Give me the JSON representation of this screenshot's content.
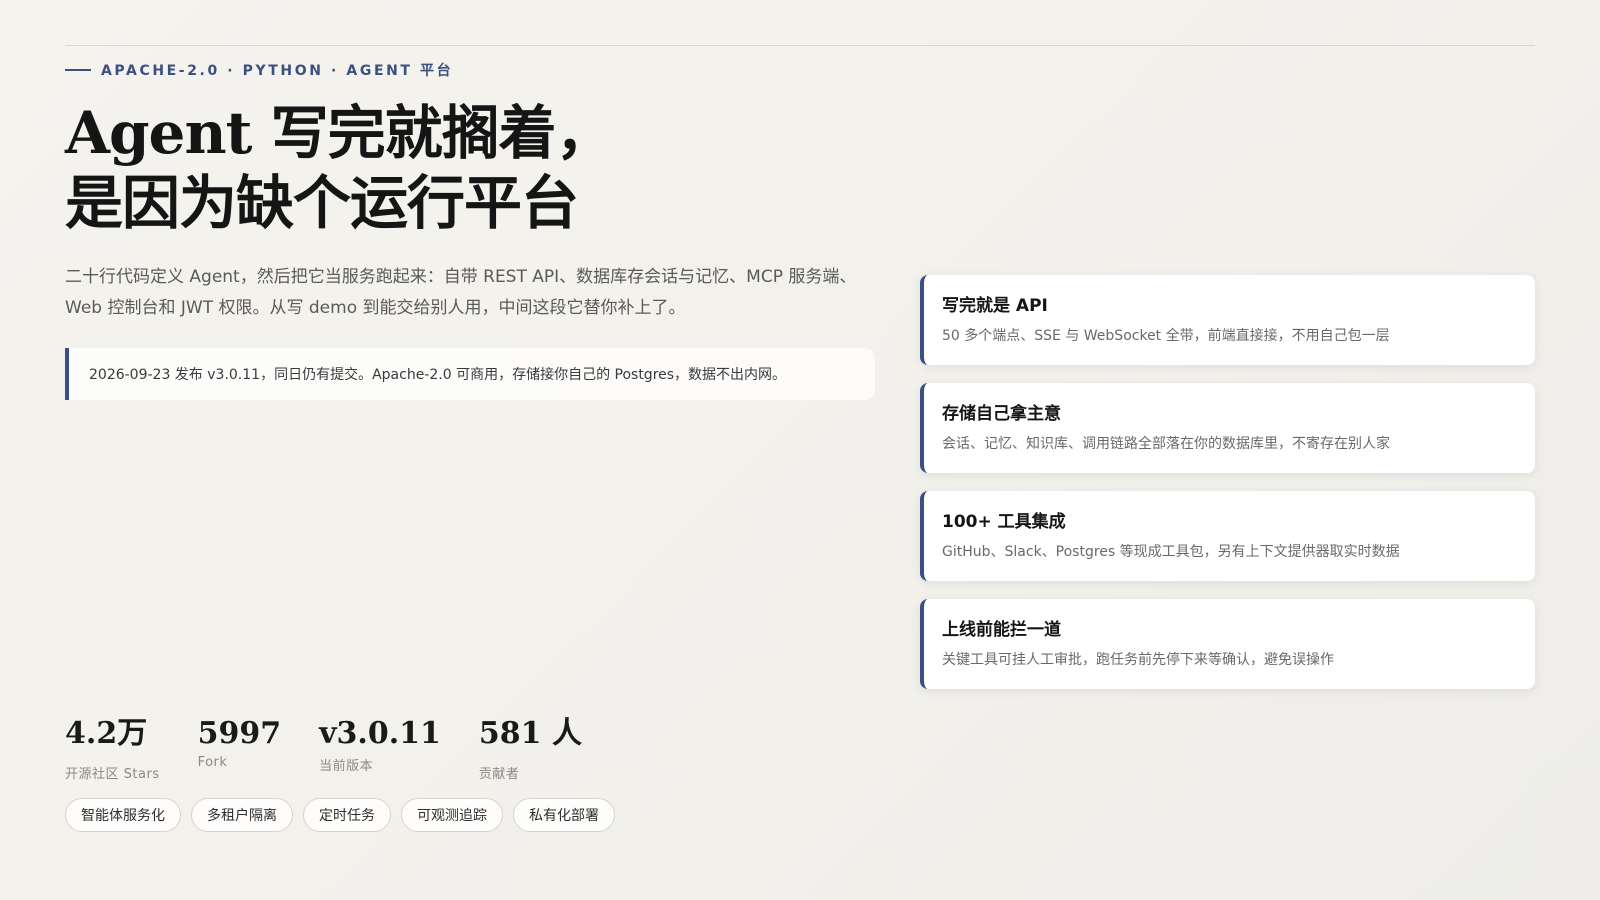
{
  "hero": {
    "eyebrow": "APACHE-2.0 · PYTHON · AGENT 平台",
    "headline_line1": "Agent 写完就搁着，",
    "headline_line2": "是因为缺个运行平台",
    "lede": "二十行代码定义 Agent，然后把它当服务跑起来：自带 REST API、数据库存会话与记忆、MCP 服务端、Web 控制台和 JWT 权限。从写 demo 到能交给别人用，中间这段它替你补上了。",
    "note": "2026-09-23 发布 v3.0.11，同日仍有提交。Apache-2.0 可商用，存储接你自己的 Postgres，数据不出内网。"
  },
  "stats": [
    {
      "value": "4.2万",
      "label": "开源社区 Stars"
    },
    {
      "value": "5997",
      "label": "Fork"
    },
    {
      "value": "v3.0.11",
      "label": "当前版本"
    },
    {
      "value": "581 人",
      "label": "贡献者"
    }
  ],
  "tags": [
    "智能体服务化",
    "多租户隔离",
    "定时任务",
    "可观测追踪",
    "私有化部署"
  ],
  "features": [
    {
      "title": "写完就是 API",
      "desc": "50 多个端点、SSE 与 WebSocket 全带，前端直接接，不用自己包一层"
    },
    {
      "title": "存储自己拿主意",
      "desc": "会话、记忆、知识库、调用链路全部落在你的数据库里，不寄存在别人家"
    },
    {
      "title": "100+ 工具集成",
      "desc": "GitHub、Slack、Postgres 等现成工具包，另有上下文提供器取实时数据"
    },
    {
      "title": "上线前能拦一道",
      "desc": "关键工具可挂人工审批，跑任务前先停下来等确认，避免误操作"
    }
  ],
  "colors": {
    "accent": "#3c4f82",
    "background": "#f3f1ec",
    "card": "#ffffff"
  }
}
